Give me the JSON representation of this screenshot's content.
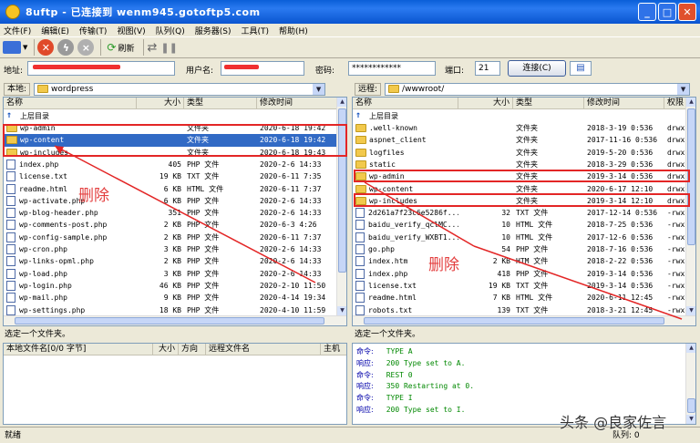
{
  "window": {
    "title": "8uftp - 已连接到 wenm945.gotoftp5.com"
  },
  "menu": [
    "文件(F)",
    "编辑(E)",
    "传输(T)",
    "视图(V)",
    "队列(Q)",
    "服务器(S)",
    "工具(T)",
    "帮助(H)"
  ],
  "toolbar": {
    "refresh_label": "刷新"
  },
  "connection": {
    "address_label": "地址:",
    "user_label": "用户名:",
    "password_label": "密码:",
    "password_value": "************",
    "port_label": "端口:",
    "port_value": "21",
    "connect_label": "连接(C)"
  },
  "local": {
    "label": "本地:",
    "path": "wordpress",
    "columns": [
      "名称",
      "大小",
      "类型",
      "修改时间"
    ],
    "up_label": "上层目录",
    "files": [
      {
        "name": "wp-admin",
        "size": "",
        "type": "文件夹",
        "date": "2020-6-18 19:42",
        "kind": "folder"
      },
      {
        "name": "wp-content",
        "size": "",
        "type": "文件夹",
        "date": "2020-6-18 19:42",
        "kind": "folder",
        "selected": true
      },
      {
        "name": "wp-includes",
        "size": "",
        "type": "文件夹",
        "date": "2020-6-18 19:43",
        "kind": "folder"
      },
      {
        "name": "index.php",
        "size": "405",
        "type": "PHP 文件",
        "date": "2020-2-6 14:33",
        "kind": "file"
      },
      {
        "name": "license.txt",
        "size": "19 KB",
        "type": "TXT 文件",
        "date": "2020-6-11 7:35",
        "kind": "file"
      },
      {
        "name": "readme.html",
        "size": "6 KB",
        "type": "HTML 文件",
        "date": "2020-6-11 7:37",
        "kind": "file"
      },
      {
        "name": "wp-activate.php",
        "size": "6 KB",
        "type": "PHP 文件",
        "date": "2020-2-6 14:33",
        "kind": "file"
      },
      {
        "name": "wp-blog-header.php",
        "size": "351",
        "type": "PHP 文件",
        "date": "2020-2-6 14:33",
        "kind": "file"
      },
      {
        "name": "wp-comments-post.php",
        "size": "2 KB",
        "type": "PHP 文件",
        "date": "2020-6-3 4:26",
        "kind": "file"
      },
      {
        "name": "wp-config-sample.php",
        "size": "2 KB",
        "type": "PHP 文件",
        "date": "2020-6-11 7:37",
        "kind": "file"
      },
      {
        "name": "wp-cron.php",
        "size": "3 KB",
        "type": "PHP 文件",
        "date": "2020-2-6 14:33",
        "kind": "file"
      },
      {
        "name": "wp-links-opml.php",
        "size": "2 KB",
        "type": "PHP 文件",
        "date": "2020-2-6 14:33",
        "kind": "file"
      },
      {
        "name": "wp-load.php",
        "size": "3 KB",
        "type": "PHP 文件",
        "date": "2020-2-6 14:33",
        "kind": "file"
      },
      {
        "name": "wp-login.php",
        "size": "46 KB",
        "type": "PHP 文件",
        "date": "2020-2-10 11:50",
        "kind": "file"
      },
      {
        "name": "wp-mail.php",
        "size": "9 KB",
        "type": "PHP 文件",
        "date": "2020-4-14 19:34",
        "kind": "file"
      },
      {
        "name": "wp-settings.php",
        "size": "18 KB",
        "type": "PHP 文件",
        "date": "2020-4-10 11:59",
        "kind": "file"
      }
    ],
    "status": "选定一个文件夹。"
  },
  "remote": {
    "label": "远程:",
    "path": "/wwwroot/",
    "columns": [
      "名称",
      "大小",
      "类型",
      "修改时间",
      "权限"
    ],
    "up_label": "上层目录",
    "files": [
      {
        "name": ".well-known",
        "size": "",
        "type": "文件夹",
        "date": "2018-3-19 0:536",
        "perm": "drwx",
        "kind": "folder"
      },
      {
        "name": "aspnet_client",
        "size": "",
        "type": "文件夹",
        "date": "2017-11-16 0:536",
        "perm": "drwx",
        "kind": "folder"
      },
      {
        "name": "logfiles",
        "size": "",
        "type": "文件夹",
        "date": "2019-5-20 0:536",
        "perm": "drwx",
        "kind": "folder"
      },
      {
        "name": "static",
        "size": "",
        "type": "文件夹",
        "date": "2018-3-29 0:536",
        "perm": "drwx",
        "kind": "folder"
      },
      {
        "name": "wp-admin",
        "size": "",
        "type": "文件夹",
        "date": "2019-3-14 0:536",
        "perm": "drwx",
        "kind": "folder"
      },
      {
        "name": "wp-content",
        "size": "",
        "type": "文件夹",
        "date": "2020-6-17 12:10",
        "perm": "drwx",
        "kind": "folder"
      },
      {
        "name": "wp-includes",
        "size": "",
        "type": "文件夹",
        "date": "2019-3-14 12:10",
        "perm": "drwx",
        "kind": "folder"
      },
      {
        "name": "2d261a7f23c6e5286f...",
        "size": "32",
        "type": "TXT 文件",
        "date": "2017-12-14 0:536",
        "perm": "-rwx",
        "kind": "file"
      },
      {
        "name": "baidu_verify_qclMC...",
        "size": "10",
        "type": "HTML 文件",
        "date": "2018-7-25 0:536",
        "perm": "-rwx",
        "kind": "file"
      },
      {
        "name": "baidu_verify_WXBT1...",
        "size": "10",
        "type": "HTML 文件",
        "date": "2017-12-6 0:536",
        "perm": "-rwx",
        "kind": "file"
      },
      {
        "name": "go.php",
        "size": "54",
        "type": "PHP 文件",
        "date": "2018-7-16 0:536",
        "perm": "-rwx",
        "kind": "file"
      },
      {
        "name": "index.htm",
        "size": "2 KB",
        "type": "HTM 文件",
        "date": "2018-2-22 0:536",
        "perm": "-rwx",
        "kind": "file"
      },
      {
        "name": "index.php",
        "size": "418",
        "type": "PHP 文件",
        "date": "2019-3-14 0:536",
        "perm": "-rwx",
        "kind": "file"
      },
      {
        "name": "license.txt",
        "size": "19 KB",
        "type": "TXT 文件",
        "date": "2019-3-14 0:536",
        "perm": "-rwx",
        "kind": "file"
      },
      {
        "name": "readme.html",
        "size": "7 KB",
        "type": "HTML 文件",
        "date": "2020-6-11 12:45",
        "perm": "-rwx",
        "kind": "file"
      },
      {
        "name": "robots.txt",
        "size": "139",
        "type": "TXT 文件",
        "date": "2018-3-21 12:45",
        "perm": "-rwx",
        "kind": "file"
      }
    ],
    "status": "选定一个文件夹。"
  },
  "queue": {
    "columns": [
      "本地文件名[0/0 字节]",
      "大小",
      "方向",
      "远程文件名",
      "主机"
    ]
  },
  "log": [
    {
      "key": "命令:",
      "val": "TYPE A"
    },
    {
      "key": "响应:",
      "val": "200 Type set to A."
    },
    {
      "key": "命令:",
      "val": "REST 0"
    },
    {
      "key": "响应:",
      "val": "350 Restarting at 0."
    },
    {
      "key": "命令:",
      "val": "TYPE I"
    },
    {
      "key": "响应:",
      "val": "200 Type set to I."
    }
  ],
  "statusbar": {
    "left": "就绪",
    "right": "队列: 0",
    "watermark": "头条 @良家佐言"
  },
  "annotations": {
    "local_delete": "删除",
    "remote_delete": "删除"
  }
}
